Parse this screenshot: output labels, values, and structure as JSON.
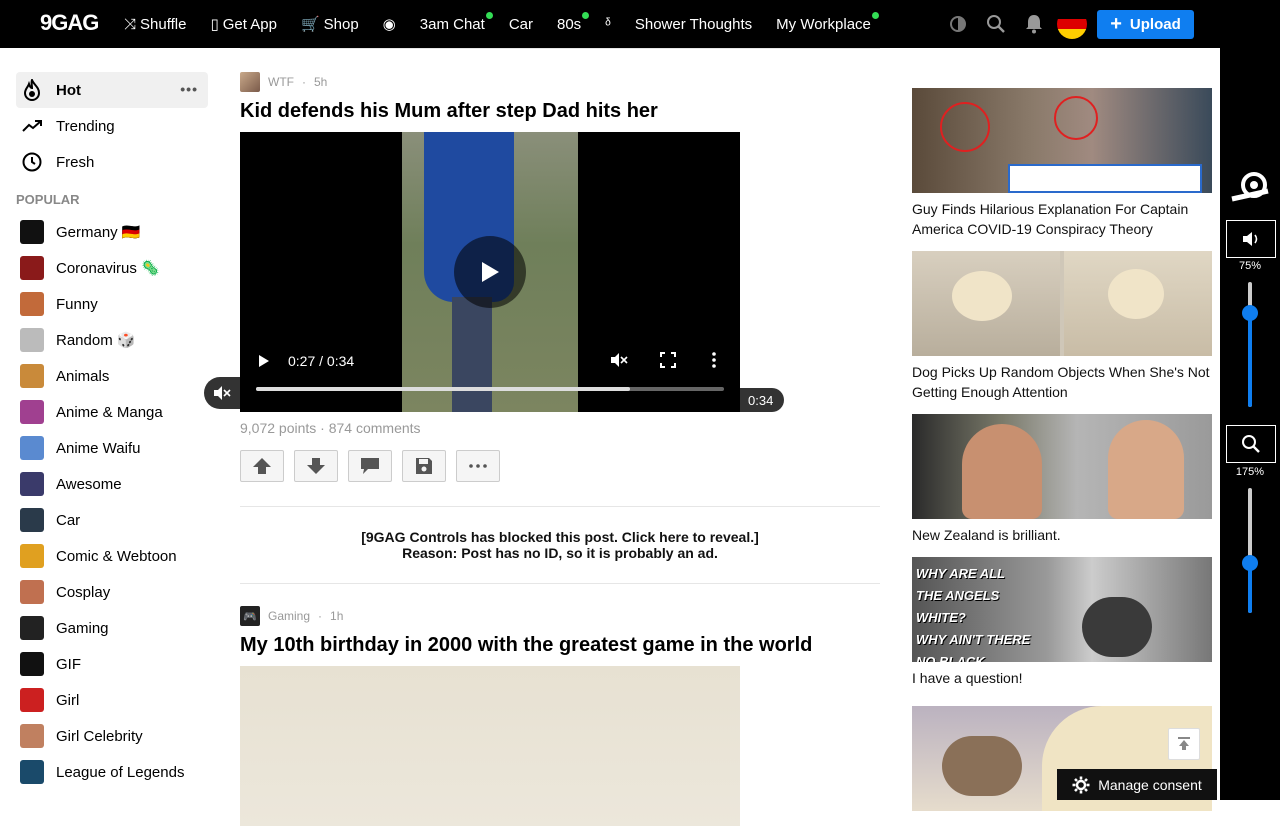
{
  "header": {
    "logo": "9GAG",
    "nav": [
      {
        "label": "Shuffle",
        "icon": "shuffle-icon",
        "dot": false
      },
      {
        "label": "Get App",
        "icon": "phone-icon",
        "dot": false
      },
      {
        "label": "Shop",
        "icon": "cart-icon",
        "dot": false
      },
      {
        "label": "",
        "icon": "clock-badge-icon",
        "dot": false
      },
      {
        "label": "3am Chat",
        "icon": "",
        "dot": true
      },
      {
        "label": "Car",
        "icon": "",
        "dot": false
      },
      {
        "label": "80s",
        "icon": "",
        "dot": true
      },
      {
        "label": "",
        "icon": "sparkle-icon",
        "dot": false
      },
      {
        "label": "Shower Thoughts",
        "icon": "",
        "dot": false
      },
      {
        "label": "My Workplace",
        "icon": "",
        "dot": true
      }
    ],
    "upload_label": "Upload"
  },
  "sidebar": {
    "primary": [
      {
        "label": "Hot",
        "icon": "fire-icon"
      },
      {
        "label": "Trending",
        "icon": "trending-icon"
      },
      {
        "label": "Fresh",
        "icon": "clock-icon"
      }
    ],
    "popular_heading": "POPULAR",
    "popular": [
      {
        "label": "Germany 🇩🇪",
        "color": "#111111"
      },
      {
        "label": "Coronavirus 🦠",
        "color": "#8a1a1a"
      },
      {
        "label": "Funny",
        "color": "#c26a3a"
      },
      {
        "label": "Random 🎲",
        "color": "#bbbbbb"
      },
      {
        "label": "Animals",
        "color": "#c98a3a"
      },
      {
        "label": "Anime & Manga",
        "color": "#a04090"
      },
      {
        "label": "Anime Waifu",
        "color": "#5a8ad0"
      },
      {
        "label": "Awesome",
        "color": "#3a3a6a"
      },
      {
        "label": "Car",
        "color": "#2a3a4a"
      },
      {
        "label": "Comic & Webtoon",
        "color": "#e0a020"
      },
      {
        "label": "Cosplay",
        "color": "#c07050"
      },
      {
        "label": "Gaming",
        "color": "#222222"
      },
      {
        "label": "GIF",
        "color": "#111111"
      },
      {
        "label": "Girl",
        "color": "#cc2020"
      },
      {
        "label": "Girl Celebrity",
        "color": "#c08060"
      },
      {
        "label": "League of Legends",
        "color": "#1a4a6a"
      }
    ]
  },
  "feed": {
    "post1": {
      "section": "WTF",
      "time": "5h",
      "title": "Kid defends his Mum after step Dad hits her",
      "time_display": "0:27 / 0:34",
      "duration": "0:34",
      "progress": 0.8,
      "stats": "9,072 points · 874 comments"
    },
    "blocked_line1": "[9GAG Controls has blocked this post. Click here to reveal.]",
    "blocked_line2": "Reason: Post has no ID, so it is probably an ad.",
    "post2": {
      "section": "Gaming",
      "time": "1h",
      "title": "My 10th birthday in 2000 with the greatest game in the world"
    }
  },
  "rightcol": [
    {
      "caption": "Guy Finds Hilarious Explanation For Captain America COVID-19 Conspiracy Theory"
    },
    {
      "caption": "Dog Picks Up Random Objects When She's Not Getting Enough Attention"
    },
    {
      "caption": "New Zealand is brilliant."
    },
    {
      "caption": "I have a question!"
    },
    {
      "caption": ""
    }
  ],
  "controls": {
    "volume_label": "75%",
    "volume_value": 0.75,
    "zoom_label": "175%",
    "zoom_value": 0.4
  },
  "consent_label": "Manage consent"
}
